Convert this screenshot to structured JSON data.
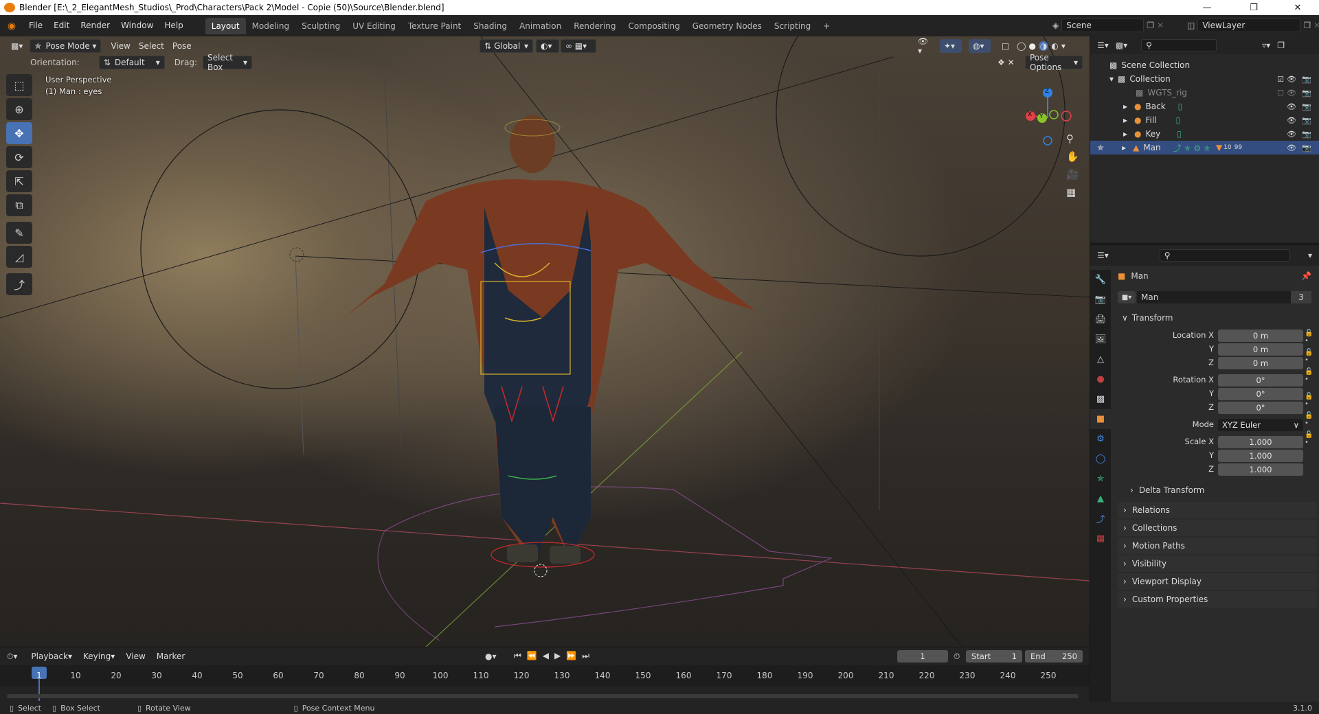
{
  "window": {
    "title": "Blender [E:\\_2_ElegantMesh_Studios\\_Prod\\Characters\\Pack 2\\Model - Copie (50)\\Source\\Blender.blend]"
  },
  "menu": [
    "File",
    "Edit",
    "Render",
    "Window",
    "Help"
  ],
  "workspaces": [
    "Layout",
    "Modeling",
    "Sculpting",
    "UV Editing",
    "Texture Paint",
    "Shading",
    "Animation",
    "Rendering",
    "Compositing",
    "Geometry Nodes",
    "Scripting"
  ],
  "active_workspace": "Layout",
  "scene": "Scene",
  "view_layer": "ViewLayer",
  "viewport": {
    "mode": "Pose Mode",
    "header_menus": [
      "View",
      "Select",
      "Pose"
    ],
    "transform_orientation": "Global",
    "orientation_label": "Orientation:",
    "orientation_value": "Default",
    "drag_label": "Drag:",
    "drag_value": "Select Box",
    "pose_options": "Pose Options",
    "overlay_text_1": "User Perspective",
    "overlay_text_2": "(1) Man : eyes",
    "gizmo": {
      "x": "X",
      "y": "Y",
      "z": "Z"
    }
  },
  "outliner": {
    "root": "Scene Collection",
    "collection": "Collection",
    "items": [
      {
        "name": "WGTS_rig",
        "dim": true
      },
      {
        "name": "Back"
      },
      {
        "name": "Fill"
      },
      {
        "name": "Key"
      },
      {
        "name": "Man",
        "selected": true,
        "badge": "10",
        "badge2": "99"
      }
    ]
  },
  "properties": {
    "object_name": "Man",
    "datablock": "Man",
    "datablock_users": "3",
    "transform_header": "Transform",
    "location_label": "Location X",
    "location": [
      "0 m",
      "0 m",
      "0 m"
    ],
    "rotation_label": "Rotation X",
    "rotation": [
      "0°",
      "0°",
      "0°"
    ],
    "mode_label": "Mode",
    "mode_value": "XYZ Euler",
    "scale_label": "Scale X",
    "scale": [
      "1.000",
      "1.000",
      "1.000"
    ],
    "y_label": "Y",
    "z_label": "Z",
    "delta": "Delta Transform",
    "panels": [
      "Relations",
      "Collections",
      "Motion Paths",
      "Visibility",
      "Viewport Display",
      "Custom Properties"
    ]
  },
  "timeline": {
    "menus": [
      "Playback",
      "Keying",
      "View",
      "Marker"
    ],
    "current_frame": "1",
    "start_label": "Start",
    "start": "1",
    "end_label": "End",
    "end": "250",
    "ticks": [
      "1",
      "10",
      "20",
      "30",
      "40",
      "50",
      "60",
      "70",
      "80",
      "90",
      "100",
      "110",
      "120",
      "130",
      "140",
      "150",
      "160",
      "170",
      "180",
      "190",
      "200",
      "210",
      "220",
      "230",
      "240",
      "250"
    ]
  },
  "statusbar": {
    "items": [
      "Select",
      "Box Select",
      "Rotate View",
      "Pose Context Menu"
    ],
    "version": "3.1.0"
  },
  "colors": {
    "accent": "#4772b3",
    "selection": "#334d80",
    "x_axis": "#e3404a",
    "y_axis": "#8ac22a",
    "z_axis": "#2f83e5"
  }
}
